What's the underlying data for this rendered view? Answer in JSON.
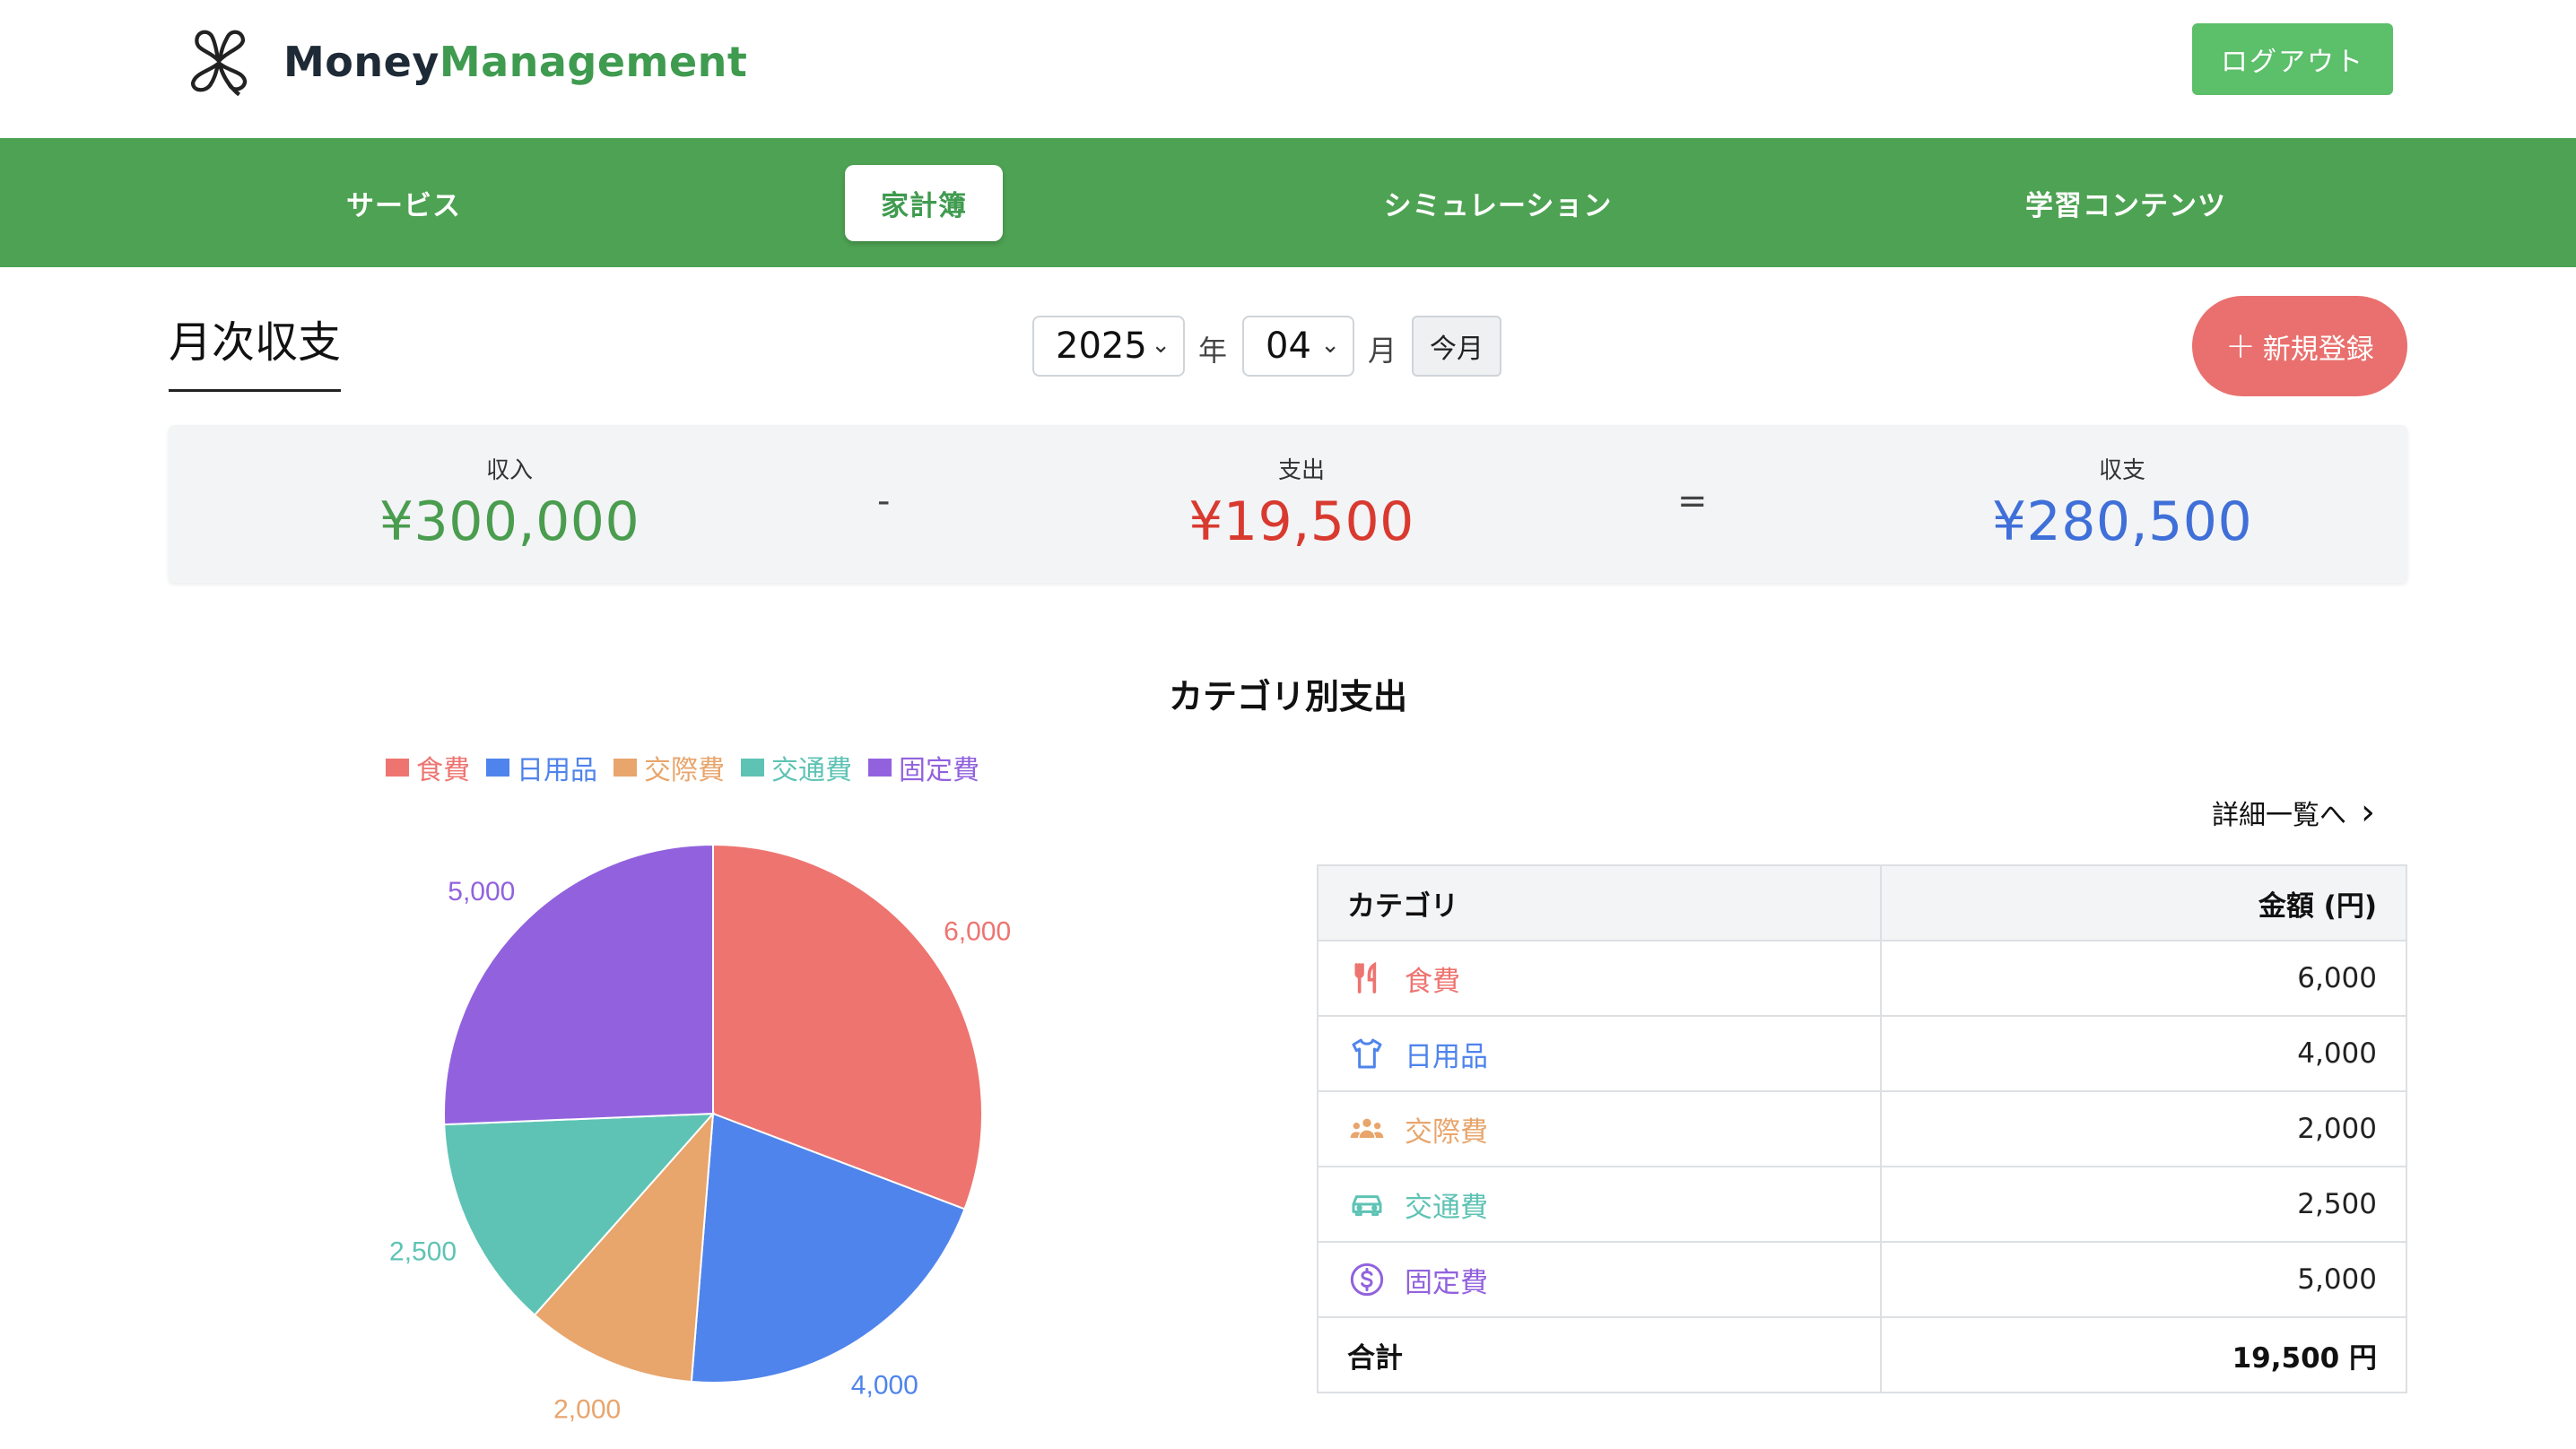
{
  "header": {
    "brand_part1": "Money",
    "brand_part2": "Management",
    "logout_label": "ログアウト"
  },
  "nav": {
    "items": [
      {
        "label": "サービス",
        "active": false
      },
      {
        "label": "家計簿",
        "active": true
      },
      {
        "label": "シミュレーション",
        "active": false
      },
      {
        "label": "学習コンテンツ",
        "active": false
      }
    ]
  },
  "page": {
    "title": "月次収支",
    "year_value": "2025",
    "year_unit": "年",
    "month_value": "04",
    "month_unit": "月",
    "today_label": "今月",
    "new_label": "新規登録"
  },
  "summary": {
    "income_label": "収入",
    "income_value": "¥300,000",
    "minus": "-",
    "expense_label": "支出",
    "expense_value": "¥19,500",
    "equals": "=",
    "balance_label": "収支",
    "balance_value": "¥280,500",
    "colors": {
      "income": "#4a9d4f",
      "expense": "#d93a30",
      "balance": "#3f6fd8"
    }
  },
  "chart_data": {
    "type": "pie",
    "title": "カテゴリ別支出",
    "categories": [
      "食費",
      "日用品",
      "交際費",
      "交通費",
      "固定費"
    ],
    "values": [
      6000,
      4000,
      2000,
      2500,
      5000
    ],
    "labels": [
      "6,000",
      "4,000",
      "2,000",
      "2,500",
      "5,000"
    ],
    "colors": [
      "#ee7470",
      "#4f84ec",
      "#e8a56c",
      "#5ec3b4",
      "#9262de"
    ],
    "legend_position": "top"
  },
  "table": {
    "detail_link": "詳細一覧へ",
    "headers": [
      "カテゴリ",
      "金額 (円)"
    ],
    "rows": [
      {
        "name": "食費",
        "amount": "6,000",
        "icon": "fork-knife-icon",
        "color": "#ee7470"
      },
      {
        "name": "日用品",
        "amount": "4,000",
        "icon": "shirt-icon",
        "color": "#4f84ec"
      },
      {
        "name": "交際費",
        "amount": "2,000",
        "icon": "people-icon",
        "color": "#e8a56c"
      },
      {
        "name": "交通費",
        "amount": "2,500",
        "icon": "car-icon",
        "color": "#5ec3b4"
      },
      {
        "name": "固定費",
        "amount": "5,000",
        "icon": "dollar-icon",
        "color": "#9262de"
      }
    ],
    "total_label": "合計",
    "total_value": "19,500 円"
  }
}
